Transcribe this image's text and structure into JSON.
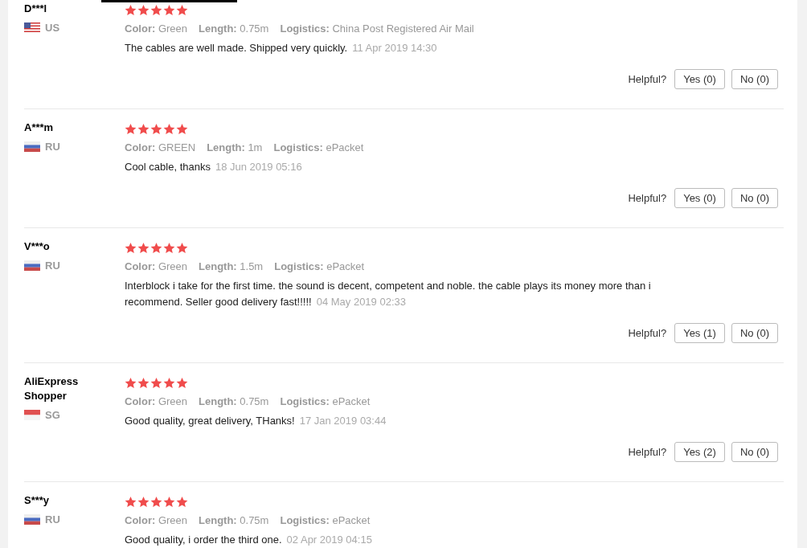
{
  "reviews": [
    {
      "name": "D***l",
      "country": "US",
      "flag": {
        "kind": "us"
      },
      "stars": 5,
      "attributes": [
        {
          "label": "Color:",
          "value": "Green"
        },
        {
          "label": "Length:",
          "value": "0.75m"
        },
        {
          "label": "Logistics:",
          "value": "China Post Registered Air Mail"
        }
      ],
      "text": "The cables are well made. Shipped very quickly.",
      "date": "11 Apr 2019 14:30",
      "helpful_label": "Helpful?",
      "yes": "Yes (0)",
      "no": "No (0)"
    },
    {
      "name": "A***m",
      "country": "RU",
      "flag": {
        "kind": "ru"
      },
      "stars": 5,
      "attributes": [
        {
          "label": "Color:",
          "value": "GREEN"
        },
        {
          "label": "Length:",
          "value": "1m"
        },
        {
          "label": "Logistics:",
          "value": "ePacket"
        }
      ],
      "text": "Cool cable, thanks",
      "date": "18 Jun 2019 05:16",
      "helpful_label": "Helpful?",
      "yes": "Yes (0)",
      "no": "No (0)"
    },
    {
      "name": "V***o",
      "country": "RU",
      "flag": {
        "kind": "ru"
      },
      "stars": 5,
      "attributes": [
        {
          "label": "Color:",
          "value": "Green"
        },
        {
          "label": "Length:",
          "value": "1.5m"
        },
        {
          "label": "Logistics:",
          "value": "ePacket"
        }
      ],
      "text": "Interblock i take for the first time. the sound is decent, competent and noble. the cable plays its money more than i recommend. Seller good delivery fast!!!!!",
      "date": "04 May 2019 02:33",
      "helpful_label": "Helpful?",
      "yes": "Yes (1)",
      "no": "No (0)"
    },
    {
      "name": "AliExpress Shopper",
      "country": "SG",
      "flag": {
        "kind": "sg"
      },
      "stars": 5,
      "attributes": [
        {
          "label": "Color:",
          "value": "Green"
        },
        {
          "label": "Length:",
          "value": "0.75m"
        },
        {
          "label": "Logistics:",
          "value": "ePacket"
        }
      ],
      "text": "Good quality, great delivery, THanks!",
      "date": "17 Jan 2019 03:44",
      "helpful_label": "Helpful?",
      "yes": "Yes (2)",
      "no": "No (0)"
    },
    {
      "name": "S***y",
      "country": "RU",
      "flag": {
        "kind": "ru"
      },
      "stars": 5,
      "attributes": [
        {
          "label": "Color:",
          "value": "Green"
        },
        {
          "label": "Length:",
          "value": "0.75m"
        },
        {
          "label": "Logistics:",
          "value": "ePacket"
        }
      ],
      "text": "Good quality, i order the third one.",
      "date": "02 Apr 2019 04:15"
    }
  ]
}
